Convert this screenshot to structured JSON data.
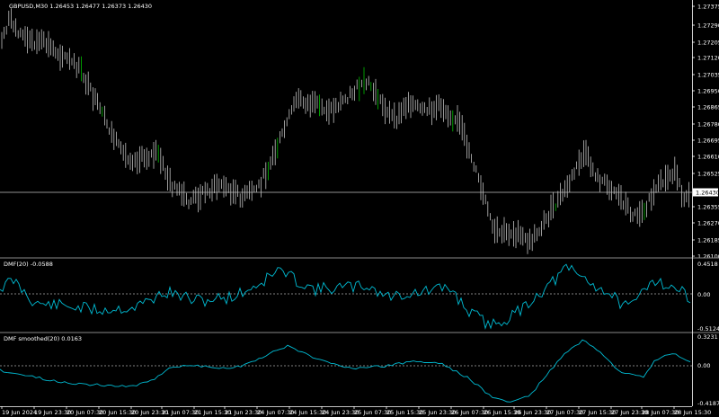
{
  "main_window": {
    "title": "GBPUSD,M30  1.26453 1.26477 1.26373 1.26430",
    "price_axis_labels": [
      "1.27375",
      "1.27290",
      "1.27205",
      "1.27120",
      "1.27035",
      "1.26950",
      "1.26865",
      "1.26780",
      "1.26695",
      "1.26610",
      "1.26525",
      "1.26355",
      "1.26270",
      "1.26185",
      "1.26100"
    ],
    "current_price_label": "1.26430",
    "current_price": 1.2643
  },
  "dmf_window": {
    "title": "DMF(20) -0.0588",
    "axis_labels": [
      "0.4518",
      "0.00",
      "-0.5124"
    ]
  },
  "dmfs_window": {
    "title": "DMF smoothed(20) 0.0163",
    "axis_labels": [
      "0.3231",
      "0.00",
      "-0.4187"
    ]
  },
  "time_axis_labels": [
    "19 Jun 2024",
    "19 Jun 23:30",
    "20 Jun 07:30",
    "20 Jun 15:30",
    "20 Jun 23:30",
    "21 Jun 07:30",
    "21 Jun 15:30",
    "21 Jun 23:30",
    "24 Jun 07:30",
    "24 Jun 15:30",
    "24 Jun 23:30",
    "25 Jun 07:30",
    "25 Jun 15:30",
    "25 Jun 23:30",
    "26 Jun 07:30",
    "26 Jun 15:30",
    "26 Jun 23:30",
    "27 Jun 07:30",
    "27 Jun 15:30",
    "27 Jun 23:30",
    "28 Jun 07:30",
    "28 Jun 15:30"
  ],
  "colors": {
    "background": "#000000",
    "bar": "#c0c0c0",
    "bar_bull_accent": "#00c000",
    "indicator_line": "#00bcd4",
    "zero_line": "#ffffff",
    "axis": "#ffffff",
    "price_line": "#c0c0c0"
  }
}
